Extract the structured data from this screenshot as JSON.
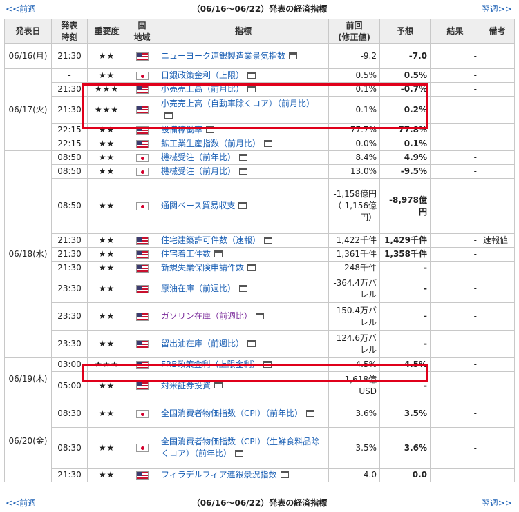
{
  "nav": {
    "prev_label": "<<前週",
    "next_label": "翌週>>",
    "title": "（06/16～06/22）発表の経済指標"
  },
  "columns": [
    "発表日",
    "発表\n時刻",
    "重要度",
    "国\n地域",
    "指標",
    "前回\n(修正値)",
    "予想",
    "結果",
    "備考"
  ],
  "rows": [
    {
      "date": "06/16(月)",
      "time": "21:30",
      "imp": "★★",
      "flag": "us",
      "indicator": "ニューヨーク連銀製造業景気指数",
      "prev": "-9.2",
      "forecast": "-7.0",
      "result": "-",
      "note": ""
    },
    {
      "date": "06/17(火)",
      "time": "-",
      "imp": "★★",
      "flag": "jp",
      "indicator": "日銀政策金利（上限）",
      "prev": "0.5%",
      "forecast": "0.5%",
      "result": "-",
      "note": ""
    },
    {
      "time": "21:30",
      "imp": "★★★",
      "flag": "us",
      "indicator": "小売売上高（前月比）",
      "prev": "0.1%",
      "forecast": "-0.7%",
      "result": "-",
      "note": ""
    },
    {
      "time": "21:30",
      "imp": "★★★",
      "flag": "us",
      "indicator": "小売売上高（自動車除くコア）（前月比）",
      "prev": "0.1%",
      "forecast": "0.2%",
      "result": "-",
      "note": ""
    },
    {
      "time": "22:15",
      "imp": "★★",
      "flag": "us",
      "indicator": "設備稼働率",
      "prev": "77.7%",
      "forecast": "77.8%",
      "result": "-",
      "note": ""
    },
    {
      "time": "22:15",
      "imp": "★★",
      "flag": "us",
      "indicator": "鉱工業生産指数（前月比）",
      "prev": "0.0%",
      "forecast": "0.1%",
      "result": "-",
      "note": ""
    },
    {
      "date": "06/18(水)",
      "time": "08:50",
      "imp": "★★",
      "flag": "jp",
      "indicator": "機械受注（前年比）",
      "prev": "8.4%",
      "forecast": "4.9%",
      "result": "-",
      "note": ""
    },
    {
      "time": "08:50",
      "imp": "★★",
      "flag": "jp",
      "indicator": "機械受注（前月比）",
      "prev": "13.0%",
      "forecast": "-9.5%",
      "result": "-",
      "note": ""
    },
    {
      "time": "08:50",
      "imp": "★★",
      "flag": "jp",
      "indicator": "通関ベース貿易収支",
      "prev": "-1,158億円（-1,156億円）",
      "forecast": "-8,978億円",
      "result": "-",
      "note": ""
    },
    {
      "time": "21:30",
      "imp": "★★",
      "flag": "us",
      "indicator": "住宅建築許可件数（速報）",
      "prev": "1,422千件",
      "forecast": "1,429千件",
      "result": "-",
      "note": "速報値"
    },
    {
      "time": "21:30",
      "imp": "★★",
      "flag": "us",
      "indicator": "住宅着工件数",
      "prev": "1,361千件",
      "forecast": "1,358千件",
      "result": "-",
      "note": ""
    },
    {
      "time": "21:30",
      "imp": "★★",
      "flag": "us",
      "indicator": "新規失業保険申請件数",
      "prev": "248千件",
      "forecast": "-",
      "result": "-",
      "note": ""
    },
    {
      "time": "23:30",
      "imp": "★★",
      "flag": "us",
      "indicator": "原油在庫（前週比）",
      "prev": "-364.4万バレル",
      "forecast": "-",
      "result": "-",
      "note": ""
    },
    {
      "time": "23:30",
      "imp": "★★",
      "flag": "us",
      "indicator": "ガソリン在庫（前週比）",
      "prev": "150.4万バレル",
      "forecast": "-",
      "result": "-",
      "note": "",
      "visited": true
    },
    {
      "time": "23:30",
      "imp": "★★",
      "flag": "us",
      "indicator": "留出油在庫（前週比）",
      "prev": "124.6万バレル",
      "forecast": "-",
      "result": "-",
      "note": ""
    },
    {
      "date": "06/19(木)",
      "time": "03:00",
      "imp": "★★★",
      "flag": "us",
      "indicator": "FRB政策金利（上限金利）",
      "prev": "4.5%",
      "forecast": "4.5%",
      "result": "-",
      "note": ""
    },
    {
      "time": "05:00",
      "imp": "★★",
      "flag": "us",
      "indicator": "対米証券投資",
      "prev": "1,618億USD",
      "forecast": "-",
      "result": "-",
      "note": ""
    },
    {
      "date": "06/20(金)",
      "time": "08:30",
      "imp": "★★",
      "flag": "jp",
      "indicator": "全国消費者物価指数（CPI）（前年比）",
      "prev": "3.6%",
      "forecast": "3.5%",
      "result": "-",
      "note": ""
    },
    {
      "time": "08:30",
      "imp": "★★",
      "flag": "jp",
      "indicator": "全国消費者物価指数（CPI）（生鮮食料品除くコア）（前年比）",
      "prev": "3.5%",
      "forecast": "3.6%",
      "result": "-",
      "note": ""
    },
    {
      "time": "21:30",
      "imp": "★★",
      "flag": "us",
      "indicator": "フィラデルフィア連銀景況指数",
      "prev": "-4.0",
      "forecast": "0.0",
      "result": "-",
      "note": ""
    }
  ]
}
